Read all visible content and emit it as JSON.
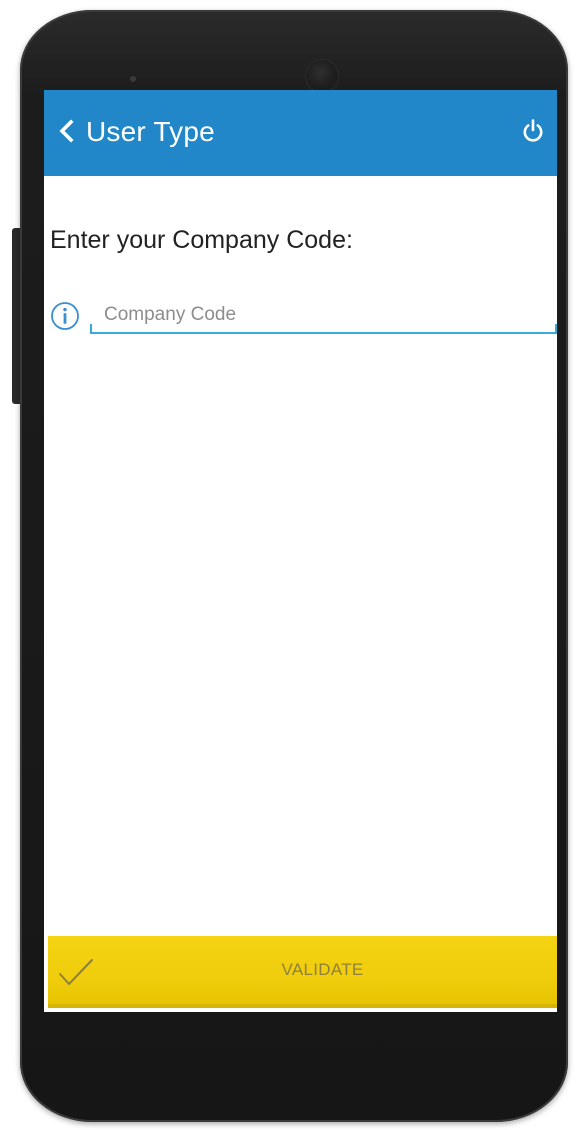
{
  "appbar": {
    "title": "User Type",
    "back_icon": "chevron-left-icon",
    "power_icon": "power-icon"
  },
  "form": {
    "prompt": "Enter your Company Code:",
    "info_icon": "info-icon",
    "company_code": {
      "placeholder": "Company Code",
      "value": ""
    }
  },
  "action": {
    "icon": "checkmark-icon",
    "label": "VALIDATE"
  },
  "colors": {
    "appbar": "#2187c8",
    "accent": "#3aaad8",
    "action_bar": "#f0cf0e",
    "action_text": "#8f7f3a"
  }
}
